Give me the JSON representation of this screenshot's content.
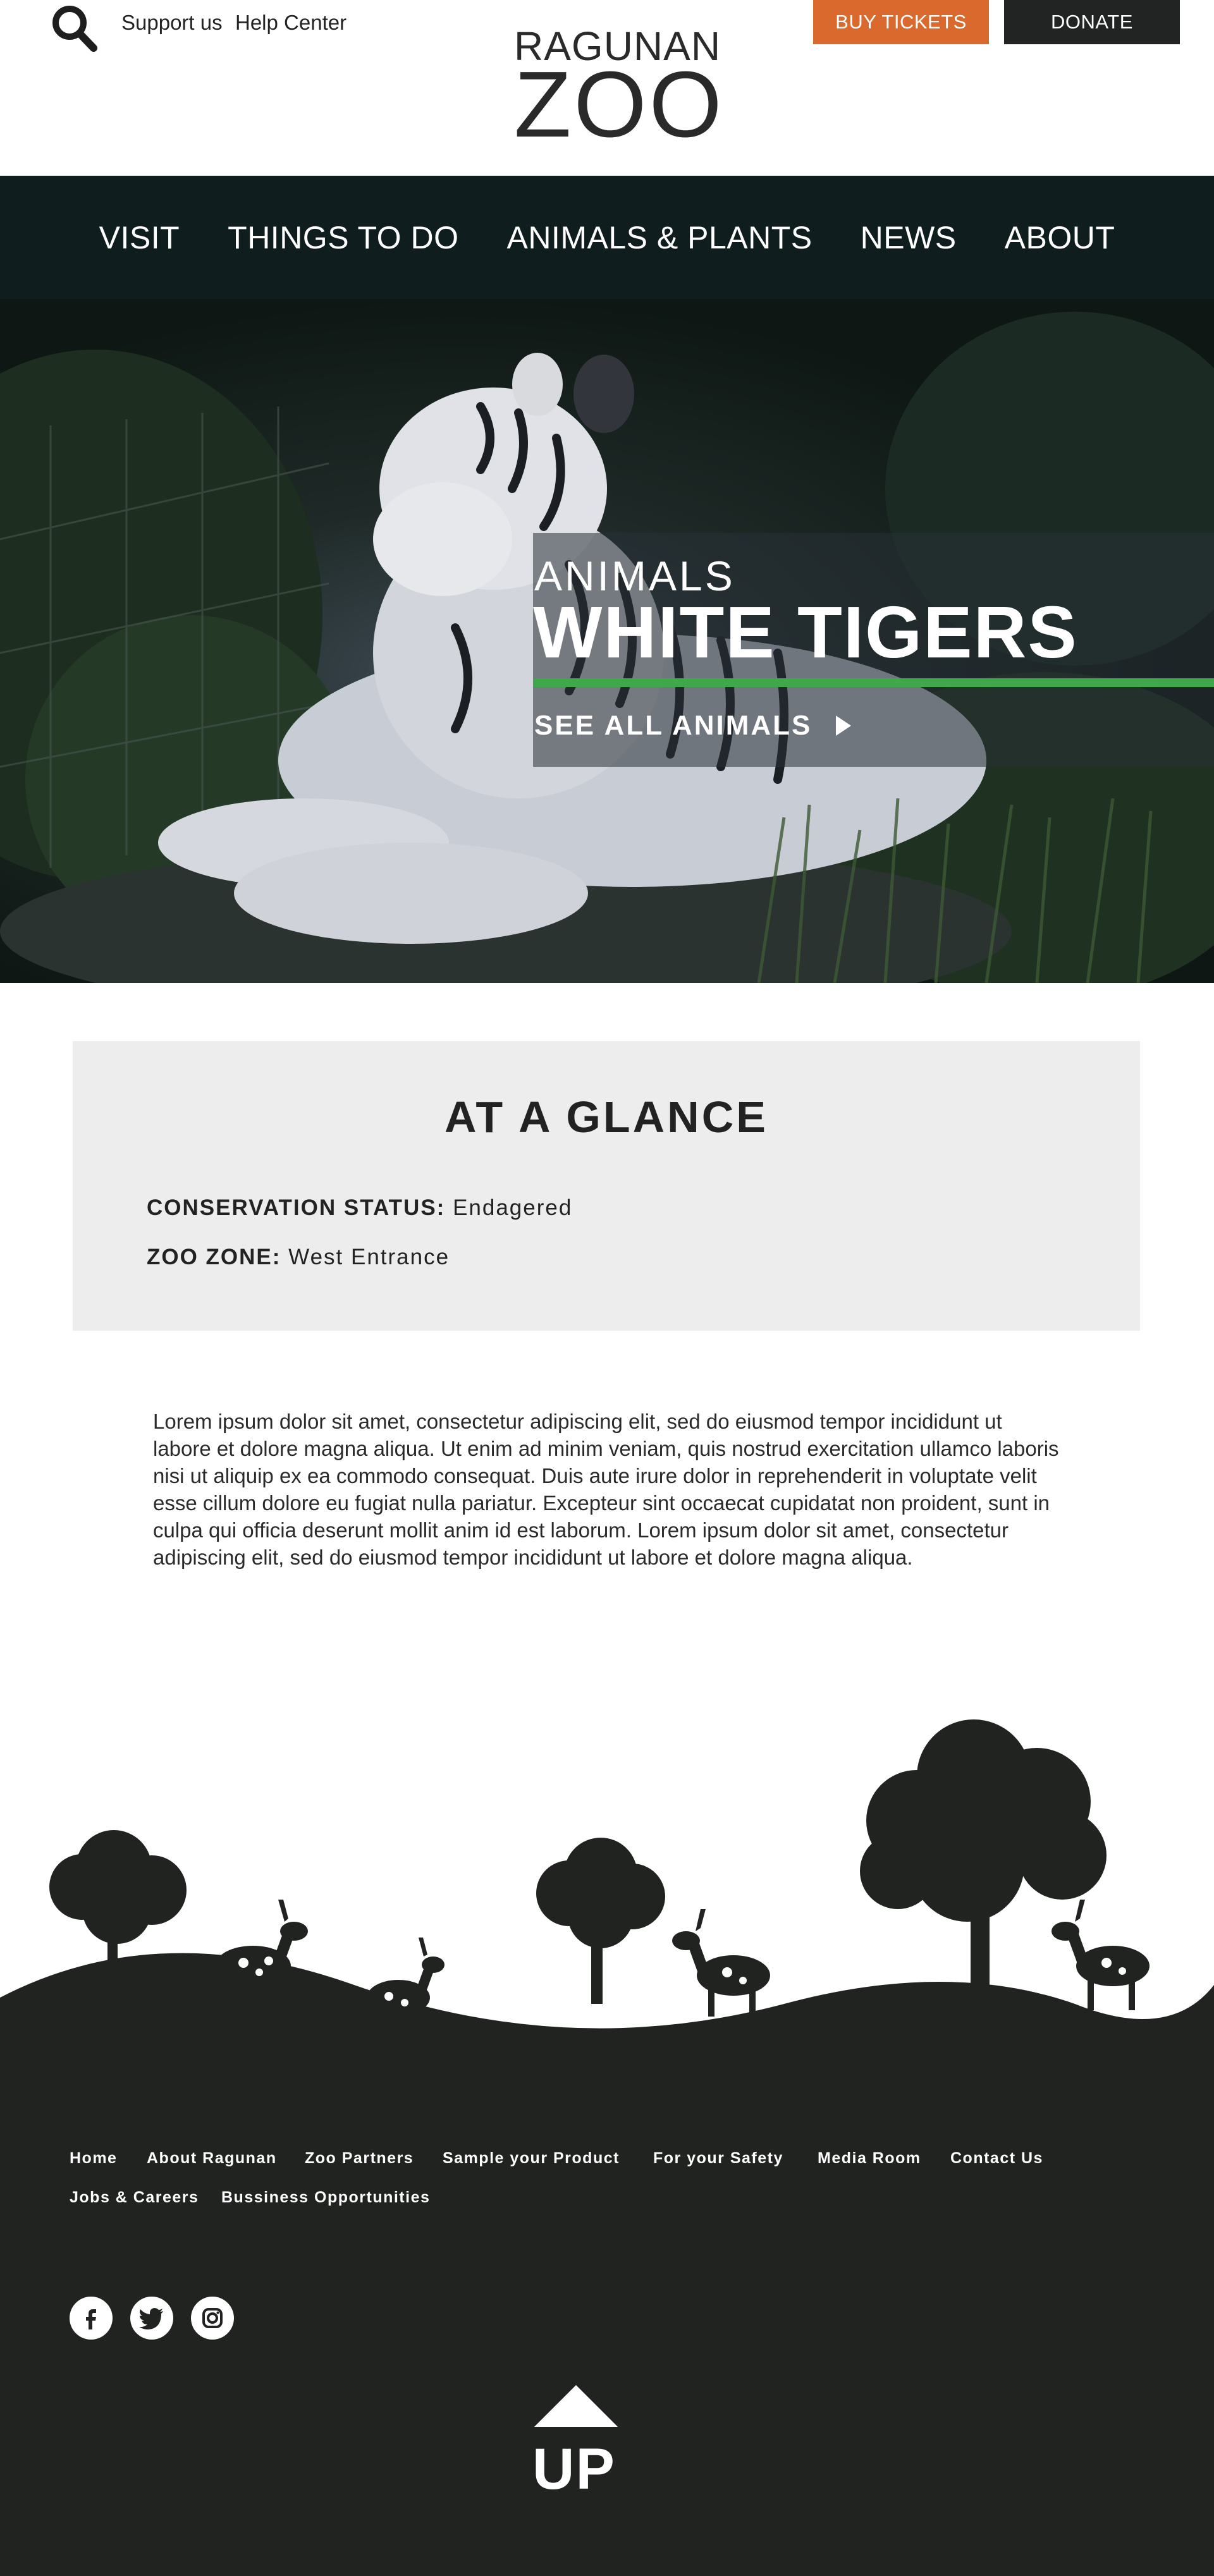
{
  "header": {
    "support_label": "Support us",
    "help_label": "Help Center",
    "logo_line1": "RAGUNAN",
    "logo_line2": "ZOO",
    "buy_tickets_label": "BUY TICKETS",
    "donate_label": "DONATE",
    "search_icon": "search-icon"
  },
  "nav": {
    "items": [
      {
        "label": "VISIT"
      },
      {
        "label": "THINGS TO DO"
      },
      {
        "label": "ANIMALS & PLANTS"
      },
      {
        "label": "NEWS"
      },
      {
        "label": "ABOUT"
      }
    ]
  },
  "hero": {
    "kicker": "ANIMALS",
    "title": "WHITE TIGERS",
    "cta_label": "SEE ALL ANIMALS",
    "accent_color": "#3fa84a"
  },
  "glance": {
    "title": "AT A GLANCE",
    "status_key": "CONSERVATION STATUS:",
    "status_value": "Endagered",
    "zone_key": "ZOO ZONE:",
    "zone_value": "West Entrance"
  },
  "body": {
    "text": "Lorem ipsum dolor sit amet, consectetur adipiscing elit, sed do eiusmod tempor incididunt ut labore et dolore magna aliqua. Ut enim ad minim veniam, quis nostrud exercitation ullamco laboris nisi ut aliquip ex ea commodo consequat. Duis aute irure dolor in reprehenderit in voluptate velit esse cillum dolore eu fugiat nulla pariatur. Excepteur sint occaecat cupidatat non proident, sunt in culpa qui officia deserunt mollit anim id est laborum. Lorem ipsum dolor sit amet, consectetur adipiscing elit, sed do eiusmod tempor incididunt ut labore et dolore magna aliqua."
  },
  "footer": {
    "links": [
      {
        "label": "Home"
      },
      {
        "label": "About Ragunan"
      },
      {
        "label": "Zoo Partners"
      },
      {
        "label": "Sample your Product"
      },
      {
        "label": "For your Safety"
      },
      {
        "label": "Media Room"
      },
      {
        "label": "Contact Us"
      },
      {
        "label": "Jobs & Careers"
      },
      {
        "label": "Bussiness Opportunities"
      }
    ],
    "social": [
      {
        "icon": "facebook-icon",
        "glyph": "f"
      },
      {
        "icon": "twitter-icon",
        "glyph": "t"
      },
      {
        "icon": "instagram-icon",
        "glyph": "◎"
      }
    ],
    "up_label": "UP"
  },
  "colors": {
    "tickets": "#d9692c",
    "donate": "#222323",
    "nav_bg": "#0f1d1f",
    "footer_bg": "#212321",
    "glance_bg": "#ededed"
  }
}
